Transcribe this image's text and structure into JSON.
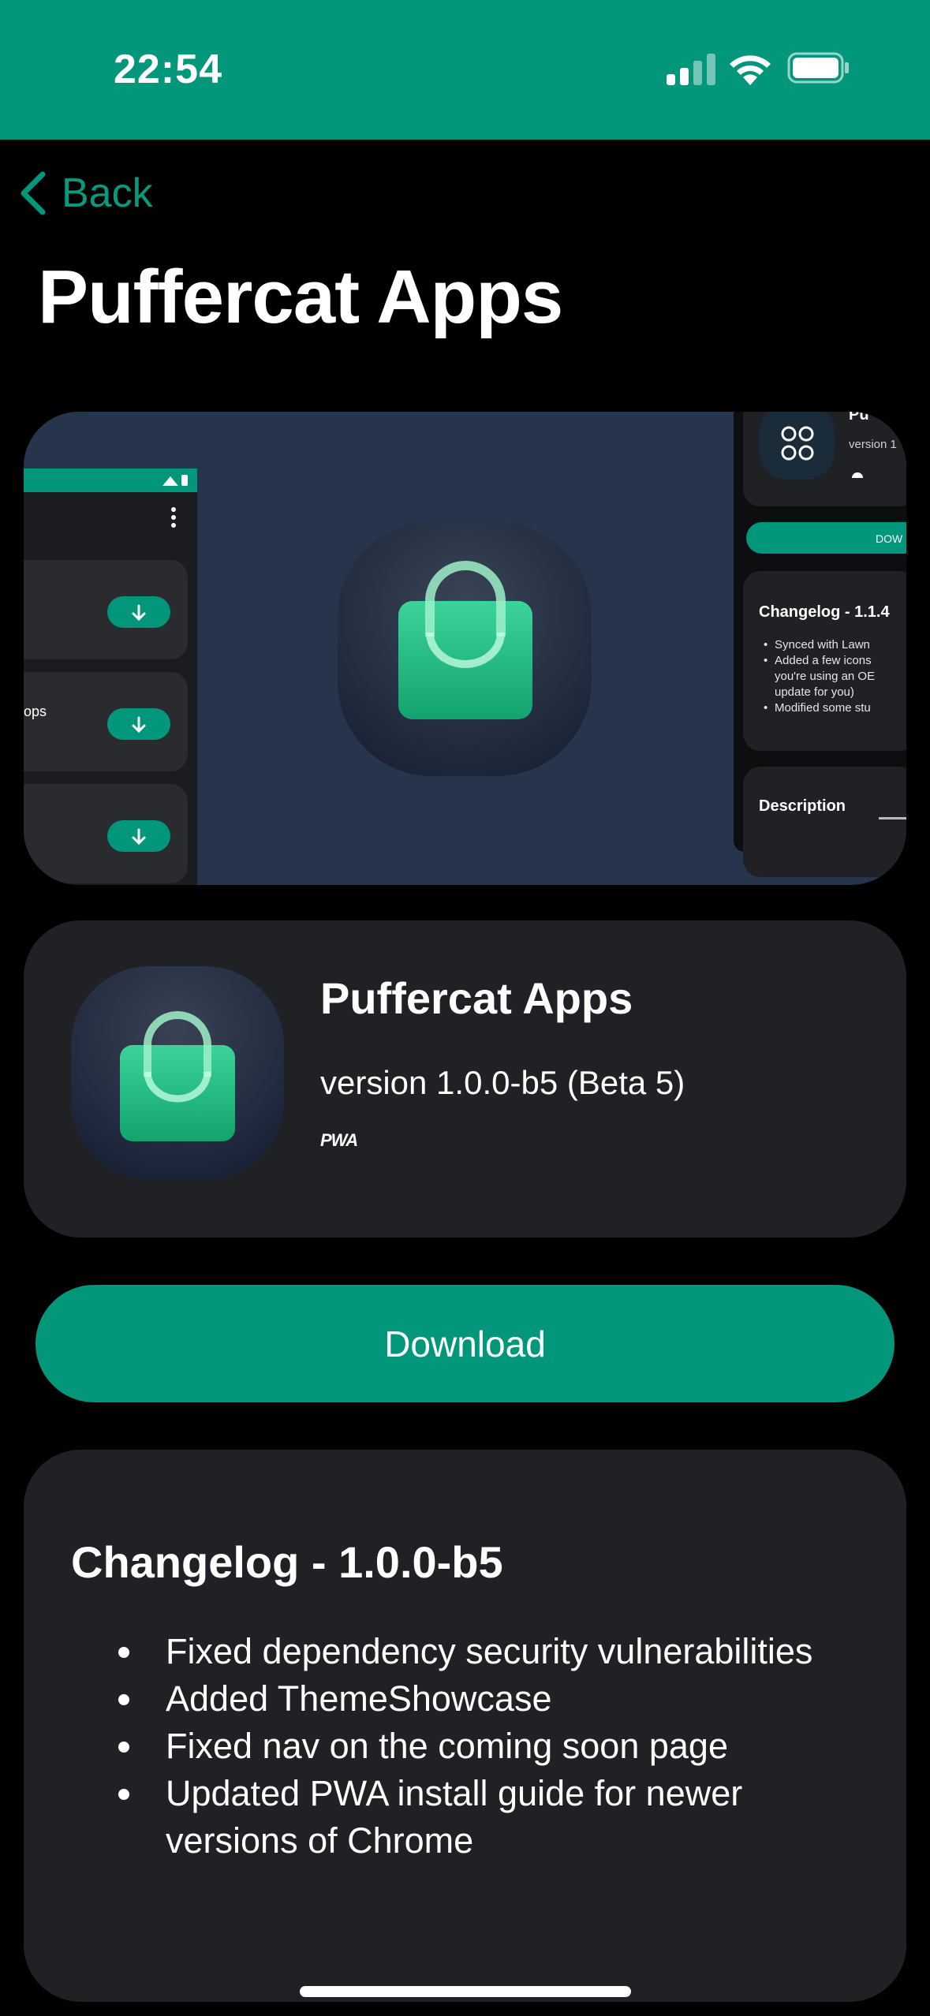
{
  "status_bar": {
    "time": "22:54",
    "background": "#02967a",
    "icons": [
      "cellular-signal-icon",
      "wifi-icon",
      "battery-icon"
    ]
  },
  "nav": {
    "back_label": "Back",
    "accent": "#02967a"
  },
  "page": {
    "title": "Puffercat Apps"
  },
  "hero_screenshot": {
    "left_list_item": "ops",
    "right_panel_title": "Pu",
    "right_panel_version": "version 1",
    "right_panel_button": "DOW",
    "right_changelog_title": "Changelog - 1.1.4",
    "right_changelog_items": [
      "Synced with Lawn",
      "Added a few icons",
      "you're using an OE",
      "update for you)",
      "Modified some stu"
    ],
    "right_description": "Description"
  },
  "app": {
    "name": "Puffercat Apps",
    "version": "version 1.0.0-b5 (Beta 5)",
    "badge": "PWA",
    "icon": "shopping-bag-icon"
  },
  "download": {
    "label": "Download"
  },
  "changelog": {
    "title": "Changelog - 1.0.0-b5",
    "items": [
      "Fixed dependency security vulnerabilities",
      "Added ThemeShowcase",
      "Fixed nav on the coming soon page",
      "Updated PWA install guide for newer versions of Chrome"
    ]
  },
  "colors": {
    "accent": "#02967a",
    "card": "#202124",
    "background": "#000000"
  }
}
